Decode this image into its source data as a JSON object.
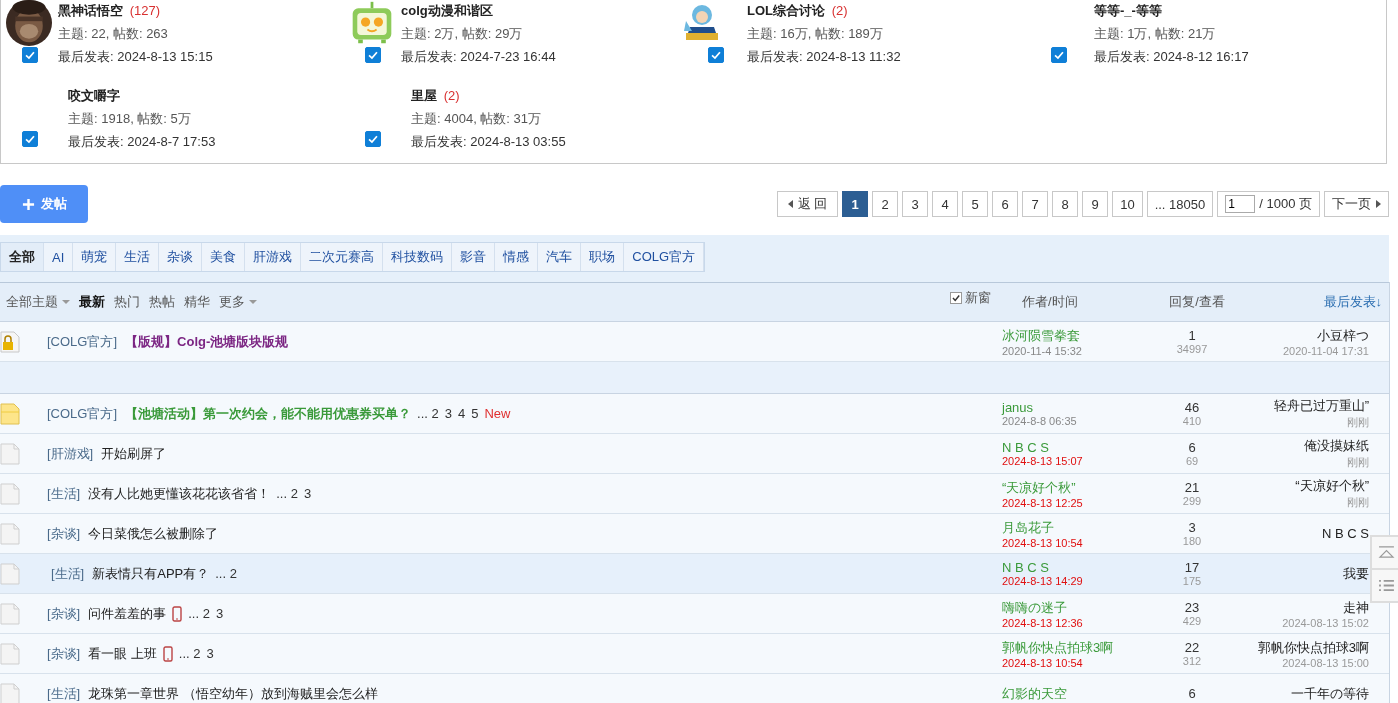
{
  "forums": [
    {
      "name": "黑神话悟空",
      "new_count": "(127)",
      "stats": "主题: 22, 帖数: 263",
      "last_post": "最后发表: 2024-8-13 15:15",
      "checked": true
    },
    {
      "kind": "mascot",
      "name": "colg动漫和谐区",
      "stats": "主题: 2万, 帖数: 29万",
      "last_post": "最后发表: 2024-7-23 16:44",
      "checked": true
    },
    {
      "kind": "figure",
      "name": "LOL综合讨论",
      "new_count": "(2)",
      "stats": "主题: 16万, 帖数: 189万",
      "last_post": "最后发表: 2024-8-13 11:32",
      "checked": true
    },
    {
      "kind": "plain",
      "name": "等等-_-等等",
      "stats": "主题: 1万, 帖数: 21万",
      "last_post": "最后发表: 2024-8-12 16:17",
      "checked": true
    },
    {
      "kind": "plain",
      "name": "咬文嚼字",
      "stats": "主题: 1918, 帖数: 5万",
      "last_post": "最后发表: 2024-8-7 17:53",
      "checked": true
    },
    {
      "kind": "plain",
      "name": "里屋",
      "new_count": "(2)",
      "stats": "主题: 4004, 帖数: 31万",
      "last_post": "最后发表: 2024-8-13 03:55",
      "checked": true
    }
  ],
  "post_button": "发帖",
  "pagination": {
    "back": "返 回",
    "pages": [
      {
        "label": "1",
        "selected": true
      },
      {
        "label": "2",
        "selected": false
      },
      {
        "label": "3",
        "selected": false
      },
      {
        "label": "4",
        "selected": false
      },
      {
        "label": "5",
        "selected": false
      },
      {
        "label": "6",
        "selected": false
      },
      {
        "label": "7",
        "selected": false
      },
      {
        "label": "8",
        "selected": false
      },
      {
        "label": "9",
        "selected": false
      },
      {
        "label": "10",
        "selected": false
      }
    ],
    "last": "... 18050",
    "page_input": "1",
    "total": "/ 1000 页",
    "next": "下一页"
  },
  "tabs": [
    {
      "label": "全部",
      "selected": true
    },
    {
      "label": "AI",
      "selected": false
    },
    {
      "label": "萌宠",
      "selected": false
    },
    {
      "label": "生活",
      "selected": false
    },
    {
      "label": "杂谈",
      "selected": false
    },
    {
      "label": "美食",
      "selected": false
    },
    {
      "label": "肝游戏",
      "selected": false
    },
    {
      "label": "二次元赛高",
      "selected": false
    },
    {
      "label": "科技数码",
      "selected": false
    },
    {
      "label": "影音",
      "selected": false
    },
    {
      "label": "情感",
      "selected": false
    },
    {
      "label": "汽车",
      "selected": false
    },
    {
      "label": "职场",
      "selected": false
    },
    {
      "label": "COLG官方",
      "selected": false
    }
  ],
  "filters": [
    {
      "label": "全部主题",
      "dropdown": true,
      "selected": false
    },
    {
      "label": "最新",
      "dropdown": false,
      "selected": true
    },
    {
      "label": "热门",
      "dropdown": false,
      "selected": false
    },
    {
      "label": "热帖",
      "dropdown": false,
      "selected": false
    },
    {
      "label": "精华",
      "dropdown": false,
      "selected": false
    },
    {
      "label": "更多",
      "dropdown": true,
      "selected": false
    }
  ],
  "new_window": {
    "label": "新窗",
    "checked": true
  },
  "columns": [
    "作者/时间",
    "回复/查看",
    "最后发表↓"
  ],
  "threads": [
    {
      "kind": "locked",
      "category": "[COLG官方]",
      "title": "【版规】Colg-池塘版块版规",
      "color": "#7b2583",
      "author": "冰河陨雪拳套",
      "date": "2020-11-4 15:32",
      "recent": false,
      "replies": "1",
      "views": "34997",
      "last_poster": "小豆梓つ",
      "last_time": "2020-11-04 17:31",
      "hovered": false
    },
    {
      "kind": "separator"
    },
    {
      "kind": "hot",
      "category": "[COLG官方]",
      "title": "【池塘活动】第一次约会，能不能用优惠券买单？",
      "color": "#3a9a3a",
      "pages": [
        "... 2",
        "3",
        "4",
        "5"
      ],
      "new_label": "New",
      "author": "janus",
      "date": "2024-8-8 06:35",
      "recent": false,
      "replies": "46",
      "views": "410",
      "last_poster": "轻舟已过万重山”",
      "last_time": "刚刚",
      "hovered": false
    },
    {
      "kind": "normal",
      "category": "[肝游戏]",
      "title": "开始刷屏了",
      "author": "N B C S",
      "date": "2024-8-13 15:07",
      "recent": true,
      "replies": "6",
      "views": "69",
      "last_poster": "俺没摸妹纸",
      "last_time": "刚刚",
      "hovered": false
    },
    {
      "kind": "normal",
      "category": "[生活]",
      "title": "没有人比她更懂该花花该省省！",
      "pages": [
        "... 2",
        "3"
      ],
      "author": "“天凉好个秋”",
      "date": "2024-8-13 12:25",
      "recent": true,
      "replies": "21",
      "views": "299",
      "last_poster": "“天凉好个秋”",
      "last_time": "刚刚",
      "hovered": false
    },
    {
      "kind": "normal",
      "category": "[杂谈]",
      "title": "今日菜俄怎么被删除了",
      "author": "月岛花子",
      "date": "2024-8-13 10:54",
      "recent": true,
      "replies": "3",
      "views": "180",
      "last_poster": "N B C S",
      "hovered": false
    },
    {
      "kind": "normal",
      "category": "[生活]",
      "title": "新表情只有APP有？",
      "pages": [
        "... 2"
      ],
      "author": "N B C S",
      "date": "2024-8-13 14:29",
      "recent": true,
      "replies": "17",
      "views": "175",
      "last_poster": "我要",
      "hovered": true
    },
    {
      "kind": "normal",
      "category": "[杂谈]",
      "title": "问件羞羞的事",
      "mobile": true,
      "pages": [
        "... 2",
        "3"
      ],
      "author": "嗨嗨の迷子",
      "date": "2024-8-13 12:36",
      "recent": true,
      "replies": "23",
      "views": "429",
      "last_poster": "走神",
      "last_time": "2024-08-13 15:02",
      "hovered": false
    },
    {
      "kind": "normal",
      "category": "[杂谈]",
      "title": "看一眼 上班",
      "mobile": true,
      "pages": [
        "... 2",
        "3"
      ],
      "author": "郭帆你快点拍球3啊",
      "date": "2024-8-13 10:54",
      "recent": true,
      "replies": "22",
      "views": "312",
      "last_poster": "郭帆你快点拍球3啊",
      "last_time": "2024-08-13 15:00",
      "hovered": false
    },
    {
      "kind": "normal",
      "category": "[生活]",
      "title": "龙珠第一章世界 （悟空幼年）放到海贼里会怎么样",
      "author": "幻影的天空",
      "replies": "6",
      "last_poster": "一千年の等待",
      "hovered": false
    }
  ]
}
